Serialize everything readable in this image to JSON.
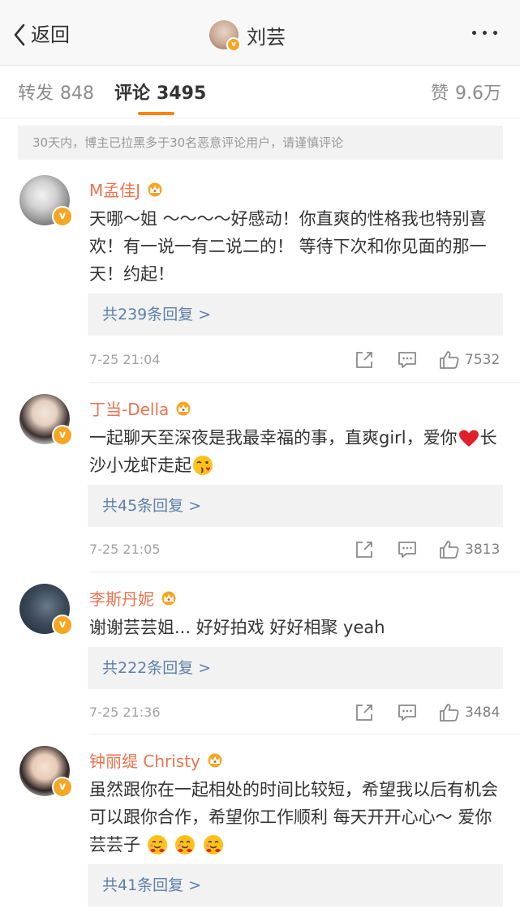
{
  "nav": {
    "back_label": "返回",
    "title": "刘芸",
    "verified_mark": "v",
    "back_icon": "chevron-left-icon",
    "more_icon": "more-dots-icon"
  },
  "tabs": {
    "repost_label": "转发",
    "repost_count": "848",
    "comment_label": "评论",
    "comment_count": "3495",
    "like_label": "赞",
    "like_count": "9.6万"
  },
  "notice": "30天内，博主已拉黑多于30名恶意评论用户，请谨慎评论",
  "colors": {
    "accent": "#ff8200",
    "username": "#eb7350",
    "reply_link": "#5d7fab",
    "verified_badge": "#f5a623",
    "crown": "#f5a623"
  },
  "icons": [
    "share-icon",
    "comment-icon",
    "thumbs-up-icon",
    "crown-icon",
    "verified-badge-icon"
  ],
  "comments": [
    {
      "name": "M孟佳J",
      "verified_mark": "v",
      "text": "天哪～姐 ～～～～好感动！你直爽的性格我也特别喜欢！有一说一有二说二的！ 等待下次和你见面的那一天！约起！",
      "replies": "共239条回复 >",
      "time": "7-25 21:04",
      "likes": "7532"
    },
    {
      "name": "丁当-Della",
      "verified_mark": "v",
      "text_a": "一起聊天至深夜是我最幸福的事，直爽girl，爱你",
      "text_b": "长沙小龙虾走起",
      "replies": "共45条回复 >",
      "time": "7-25 21:05",
      "likes": "3813"
    },
    {
      "name": "李斯丹妮",
      "verified_mark": "v",
      "text": "谢谢芸芸姐... 好好拍戏 好好相聚 yeah",
      "replies": "共222条回复 >",
      "time": "7-25 21:36",
      "likes": "3484"
    },
    {
      "name": "钟丽缇 Christy",
      "verified_mark": "v",
      "text": "虽然跟你在一起相处的时间比较短，希望我以后有机会可以跟你合作，希望你工作顺利 每天开开心心～ 爱你芸芸子",
      "replies": "共41条回复 >"
    }
  ]
}
